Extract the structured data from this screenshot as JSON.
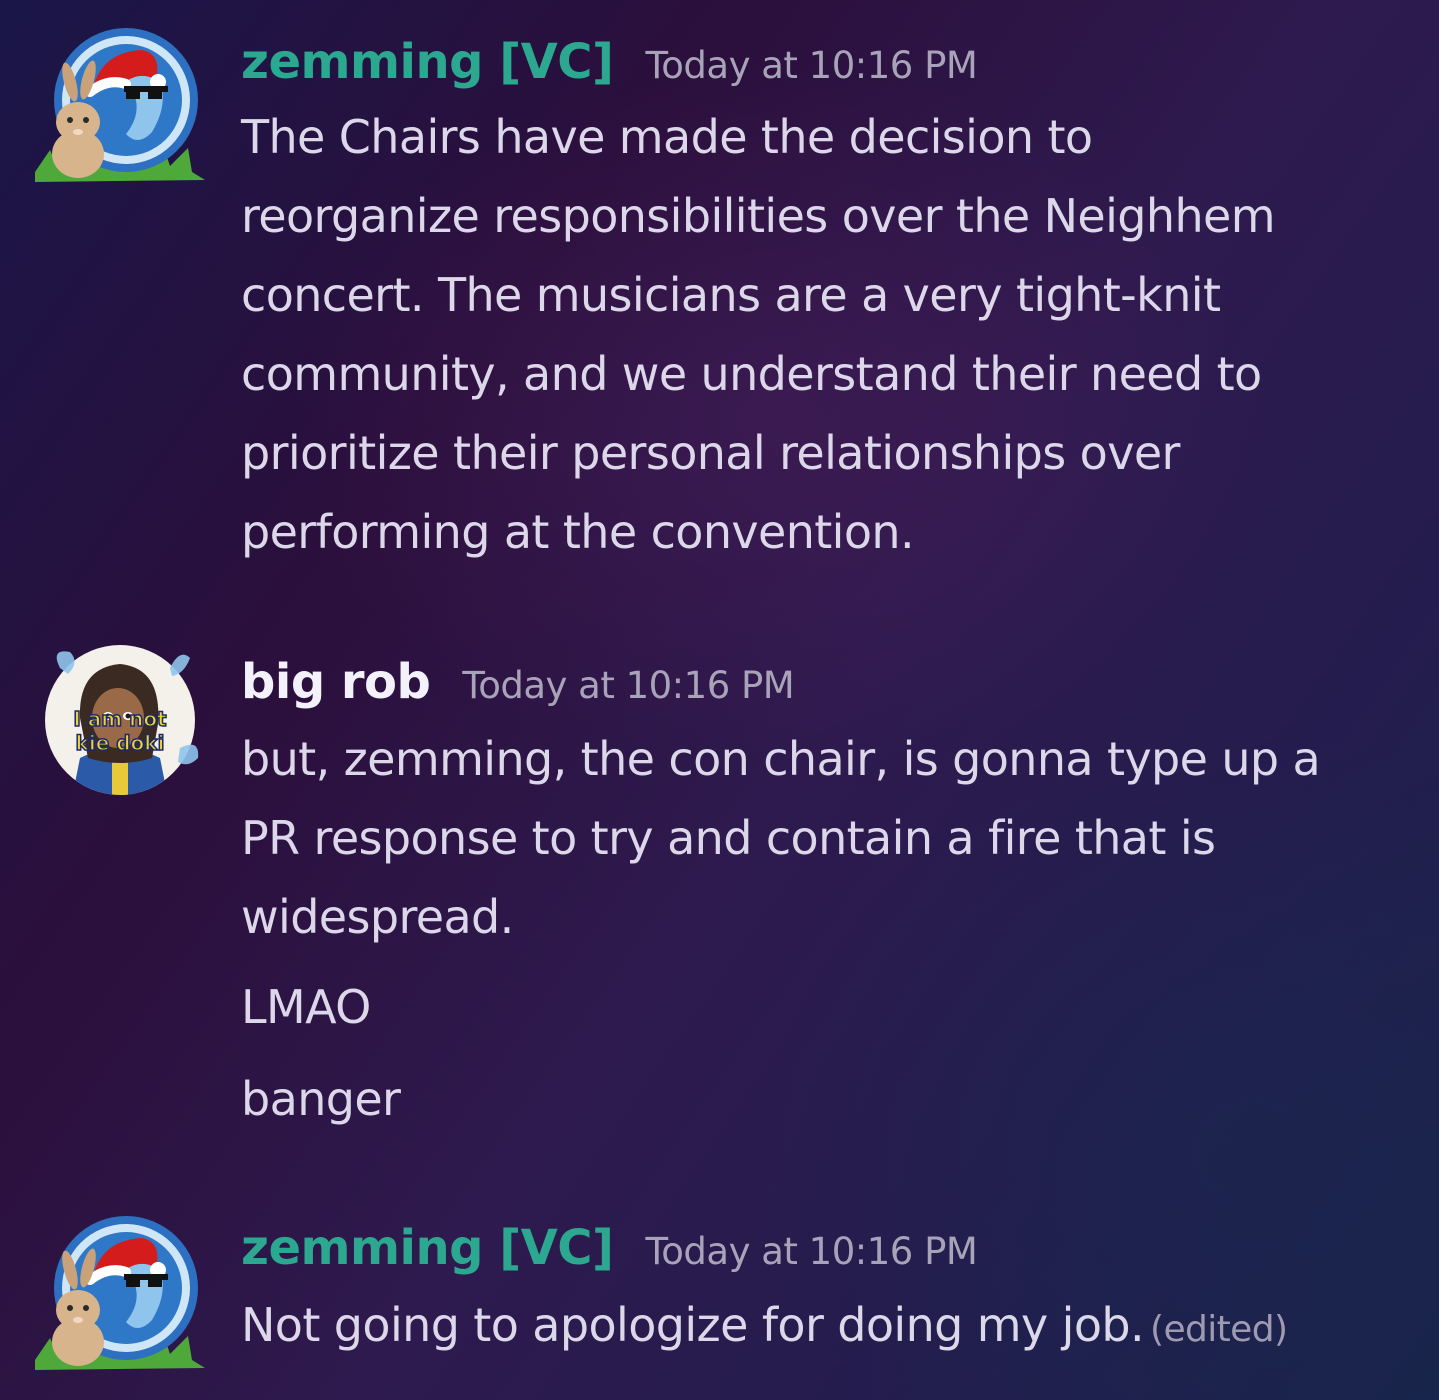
{
  "messages": [
    {
      "username": "zemming [VC]",
      "timestamp": "Today at 10:16 PM",
      "lines": [
        "The Chairs have made the decision to",
        "reorganize responsibilities over the Neighhem",
        "concert. The musicians are a very tight-knit",
        "community, and we understand their need to",
        "prioritize their personal relationships over",
        "performing at the convention."
      ]
    },
    {
      "username": "big rob",
      "timestamp": "Today at 10:16 PM",
      "avatar_caption_line1": "I am not",
      "avatar_caption_line2": "kie doki",
      "lines": [
        "but, zemming, the con chair, is gonna type up a",
        "PR response to try and contain a fire that is",
        "widespread."
      ],
      "followups": [
        "LMAO",
        "banger"
      ]
    },
    {
      "username": "zemming [VC]",
      "timestamp": "Today at 10:16 PM",
      "text": "Not going to apologize for doing my job.",
      "edited_label": "(edited)"
    }
  ],
  "colors": {
    "vc_username": "#2ba88f",
    "username": "#f3f1fa",
    "message_text": "#dcd8ea",
    "timestamp": "#a8a3b8"
  },
  "icons": [
    "zemming-avatar",
    "santa-hat-icon",
    "bunny-icon",
    "big-rob-avatar"
  ]
}
